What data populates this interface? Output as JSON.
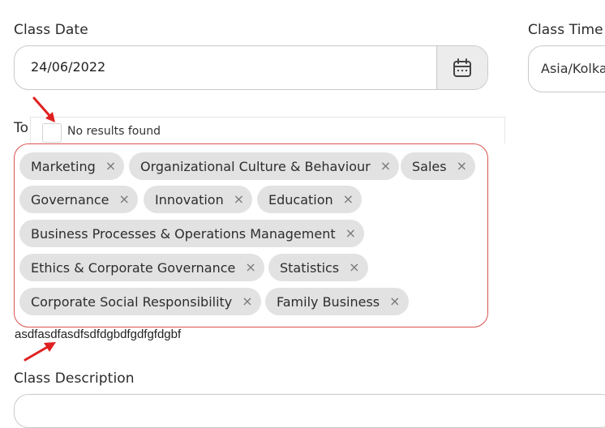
{
  "class_date": {
    "label": "Class Date",
    "value": "24/06/2022"
  },
  "class_time": {
    "label": "Class Time",
    "value": "Asia/Kolkata"
  },
  "topics": {
    "label": "To",
    "dropdown_message": "No results found",
    "tags": [
      "Marketing",
      "Organizational Culture & Behaviour",
      "Sales",
      "Governance",
      "Innovation",
      "Education",
      "Business Processes & Operations Management",
      "Ethics & Corporate Governance",
      "Statistics",
      "Corporate Social Responsibility",
      "Family Business"
    ],
    "remove_glyph": "×"
  },
  "typed_text": "asdfasdfasdfsdfdgbdfgdfgfdgbf",
  "class_description": {
    "label": "Class Description"
  },
  "colors": {
    "error_border": "#d9534f",
    "annotation_arrow": "#e02020",
    "tag_bg": "#e2e2e2"
  },
  "icons": {
    "date_picker": "calendar-icon"
  }
}
